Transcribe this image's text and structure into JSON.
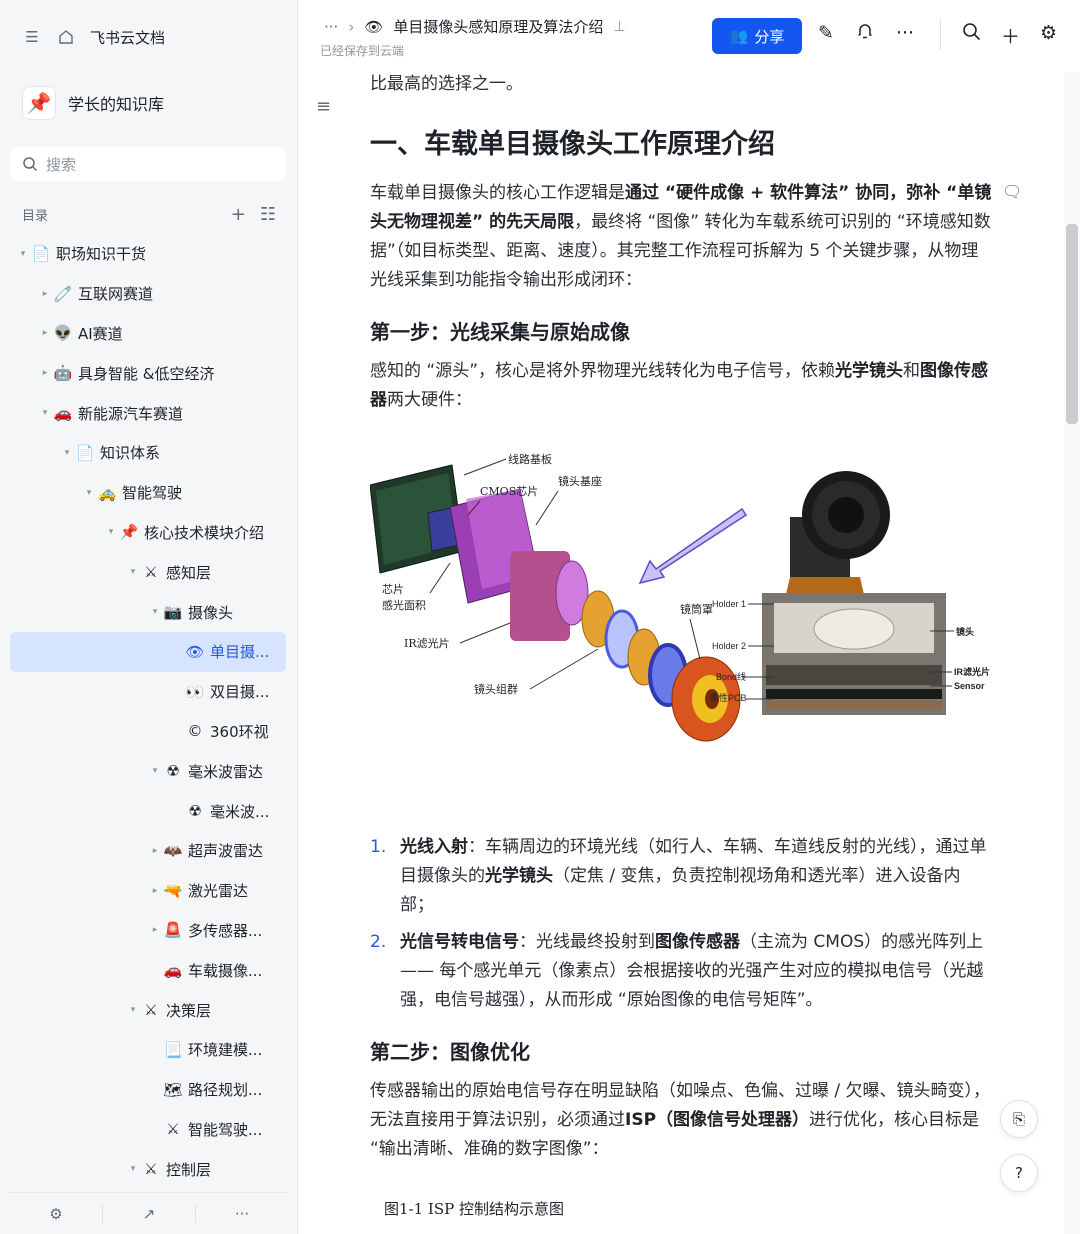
{
  "sidebar": {
    "app_name": "飞书云文档",
    "kb_title": "学长的知识库",
    "search_placeholder": "搜索",
    "toc_label": "目录",
    "tree": [
      {
        "label": "职场知识干货",
        "level": 0,
        "arrow": "▾",
        "emoji": "📄"
      },
      {
        "label": "互联网赛道",
        "level": 1,
        "arrow": "▸",
        "emoji": "🧷"
      },
      {
        "label": "AI赛道",
        "level": 1,
        "arrow": "▸",
        "emoji": "👽"
      },
      {
        "label": "具身智能 &低空经济",
        "level": 1,
        "arrow": "▸",
        "emoji": "🤖"
      },
      {
        "label": "新能源汽车赛道",
        "level": 1,
        "arrow": "▾",
        "emoji": "🚗"
      },
      {
        "label": "知识体系",
        "level": 2,
        "arrow": "▾",
        "emoji": "📄"
      },
      {
        "label": "智能驾驶",
        "level": 3,
        "arrow": "▾",
        "emoji": "🚕"
      },
      {
        "label": "核心技术模块介绍",
        "level": 4,
        "arrow": "▾",
        "emoji": "📌"
      },
      {
        "label": "感知层",
        "level": 5,
        "arrow": "▾",
        "emoji": "⚔"
      },
      {
        "label": "摄像头",
        "level": 6,
        "arrow": "▾",
        "emoji": "📷"
      },
      {
        "label": "单目摄...",
        "level": 7,
        "arrow": "",
        "emoji": "👁"
      },
      {
        "label": "双目摄...",
        "level": 7,
        "arrow": "",
        "emoji": "👀"
      },
      {
        "label": "360环视",
        "level": 7,
        "arrow": "",
        "emoji": "©"
      },
      {
        "label": "毫米波雷达",
        "level": 6,
        "arrow": "▾",
        "emoji": "☢"
      },
      {
        "label": "毫米波...",
        "level": 7,
        "arrow": "",
        "emoji": "☢"
      },
      {
        "label": "超声波雷达",
        "level": 6,
        "arrow": "▸",
        "emoji": "🦇"
      },
      {
        "label": "激光雷达",
        "level": 6,
        "arrow": "▸",
        "emoji": "🔫"
      },
      {
        "label": "多传感器...",
        "level": 6,
        "arrow": "▸",
        "emoji": "🚨"
      },
      {
        "label": "车载摄像...",
        "level": 6,
        "arrow": "",
        "emoji": "🚗"
      },
      {
        "label": "决策层",
        "level": 5,
        "arrow": "▾",
        "emoji": "⚔"
      },
      {
        "label": "环境建模...",
        "level": 6,
        "arrow": "",
        "emoji": "📃"
      },
      {
        "label": "路径规划...",
        "level": 6,
        "arrow": "",
        "emoji": "🗺"
      },
      {
        "label": "智能驾驶...",
        "level": 6,
        "arrow": "",
        "emoji": "⚔"
      },
      {
        "label": "控制层",
        "level": 5,
        "arrow": "▾",
        "emoji": "⚔"
      }
    ],
    "selected_index": 10
  },
  "header": {
    "more": "···",
    "chevron": "›",
    "doc_title": "单目摄像头感知原理及算法介绍",
    "saved_status": "已经保存到云端",
    "share_label": "分享"
  },
  "doc": {
    "intro_tail": "比最高的选择之一。",
    "h1": "一、车载单目摄像头工作原理介绍",
    "p1": {
      "a": "车载单目摄像头的核心工作逻辑是",
      "b": "通过 “硬件成像 + 软件算法” 协同，弥补 “单镜头无物理视差” 的先天局限",
      "c": "，最终将 “图像” 转化为车载系统可识别的 “环境感知数据”（如目标类型、距离、速度）。其完整工作流程可拆解为 5 个关键步骤，从物理光线采集到功能指令输出形成闭环："
    },
    "step1_title": "第一步：光线采集与原始成像",
    "p2": {
      "a": "感知的 “源头”，核心是将外界物理光线转化为电子信号，依赖",
      "b": "光学镜头",
      "c": "和",
      "d": "图像传感器",
      "e": "两大硬件："
    },
    "figure_labels": {
      "board": "线路基板",
      "cmos": "CMOS芯片",
      "mount": "镜头基座",
      "chip_area": "芯片\n感光面积",
      "ir": "IR滤光片",
      "lens_group": "镜头组群",
      "lens_cover": "镜筒罩",
      "holder1": "Holder 1",
      "holder2": "Holder 2",
      "bond": "Bond线",
      "fpcb": "柔性PCB",
      "lens": "镜头",
      "ir_filter": "IR滤光片",
      "sensor": "Sensor"
    },
    "list1": [
      {
        "num": "1.",
        "bold": "光线入射",
        "text_a": "：车辆周边的环境光线（如行人、车辆、车道线反射的光线），通过单目摄像头的",
        "bold2": "光学镜头",
        "text_b": "（定焦 / 变焦，负责控制视场角和透光率）进入设备内部；"
      },
      {
        "num": "2.",
        "bold": "光信号转电信号",
        "text_a": "：光线最终投射到",
        "bold2": "图像传感器",
        "text_b": "（主流为 CMOS）的感光阵列上 —— 每个感光单元（像素点）会根据接收的光强产生对应的模拟电信号（光越强，电信号越强），从而形成 “原始图像的电信号矩阵”。"
      }
    ],
    "step2_title": "第二步：图像优化",
    "p3": {
      "a": "传感器输出的原始电信号存在明显缺陷（如噪点、色偏、过曝 / 欠曝、镜头畸变），无法直接用于算法识别，必须通过",
      "b": "ISP（图像信号处理器）",
      "c": "进行优化，核心目标是 “输出清晰、准确的数字图像”："
    },
    "caption": "图1-1  ISP 控制结构示意图"
  },
  "colors": {
    "accent": "#1456f0",
    "selected_bg": "#d6e4ff",
    "sidebar_bg": "#f5f6f7"
  }
}
